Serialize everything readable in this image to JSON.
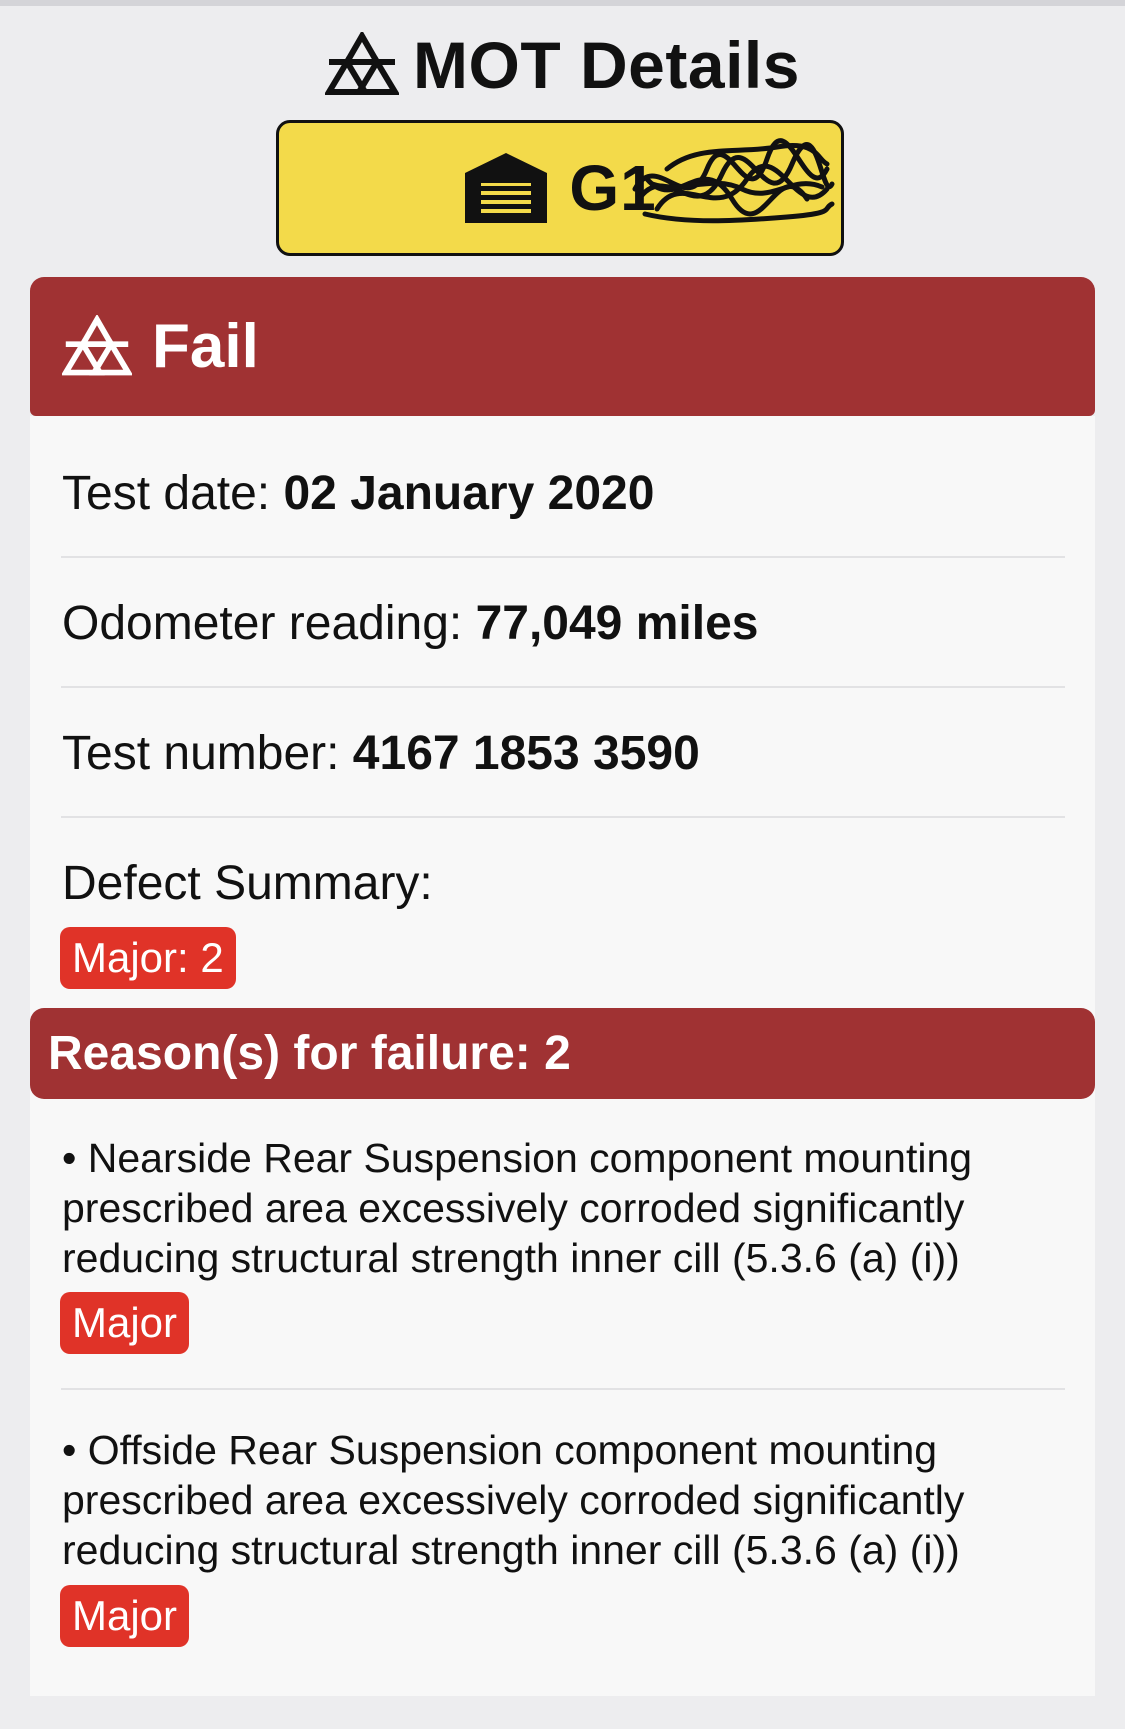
{
  "header": {
    "title": "MOT Details",
    "icon": "mot-triangle-icon"
  },
  "plate": {
    "registration": "G1",
    "icon": "garage-icon",
    "redacted": true
  },
  "status": {
    "label": "Fail",
    "icon": "mot-triangle-icon"
  },
  "details": {
    "test_date_label": "Test date: ",
    "test_date_value": "02 January 2020",
    "odometer_label": "Odometer reading: ",
    "odometer_value": "77,049 miles",
    "test_number_label": "Test number: ",
    "test_number_value": "4167 1853 3590",
    "defect_summary_label": "Defect Summary:",
    "defect_summary_badge": "Major: 2"
  },
  "reasons": {
    "label": "Reason(s) for failure: 2",
    "items": [
      {
        "lines": [
          "• Nearside Rear Suspension component mounting",
          "prescribed area excessively corroded significantly",
          "reducing structural strength  inner cill (5.3.6 (a) (i))"
        ],
        "severity": "Major"
      },
      {
        "lines": [
          "• Offside Rear Suspension component mounting",
          "prescribed area excessively corroded significantly",
          "reducing structural strength  inner cill (5.3.6 (a) (i))"
        ],
        "severity": "Major"
      }
    ]
  },
  "colors": {
    "fail_red": "#a03233",
    "badge_red": "#e03328",
    "plate_yellow": "#f3da4a"
  }
}
